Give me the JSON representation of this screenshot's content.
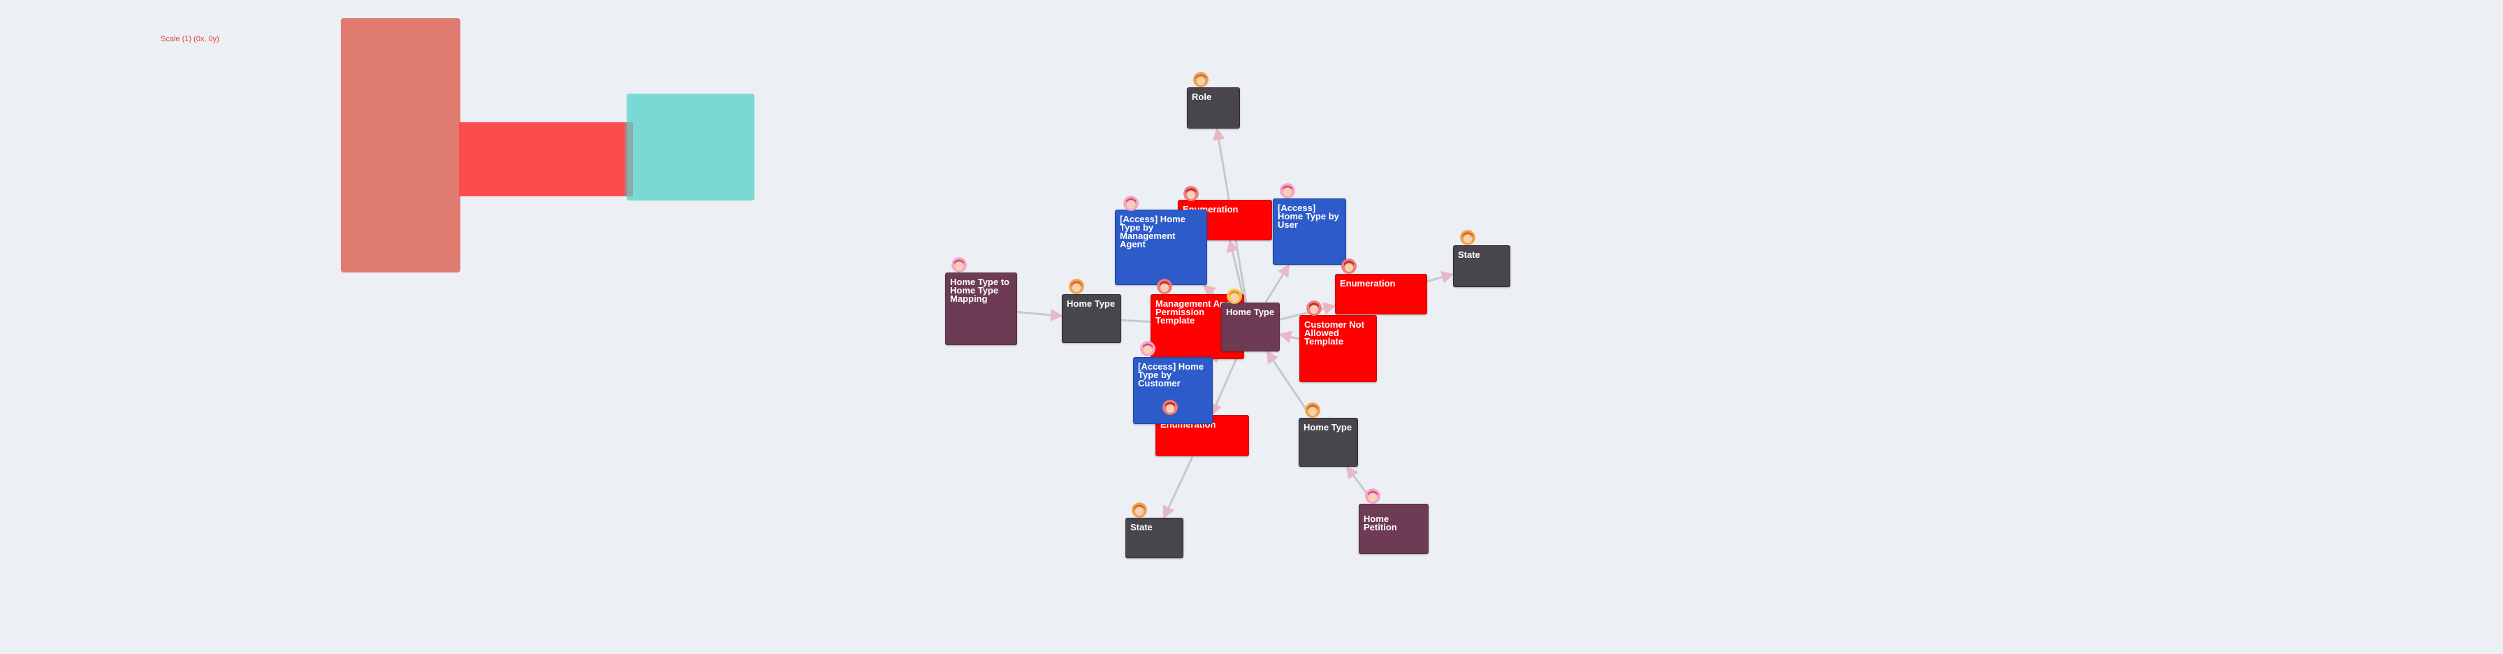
{
  "scale_label": "Scale (1) (0x, 0y)",
  "colors": {
    "background": "#eceff3",
    "minimap_block_a": "#e07b72",
    "minimap_block_b": "#fd4c4e",
    "minimap_block_c": "#7ad9d3",
    "node_dark": "#48464c",
    "node_red": "#fe0000",
    "node_blue": "#2d5bc9",
    "node_plum": "#6e3b55",
    "edge": "#c8c8cc"
  },
  "nodes": {
    "role": {
      "label": "Role",
      "type": "dark",
      "avatar": "orange-avatar-icon"
    },
    "enum_top": {
      "label": "Enumeration",
      "type": "red",
      "avatar": "red-avatar-icon"
    },
    "access_mgmt": {
      "label": "[Access] Home Type by Management Agent",
      "type": "blue",
      "avatar": "pink-avatar-icon"
    },
    "access_user": {
      "label": "[Access] Home Type by User",
      "type": "blue",
      "avatar": "pink-avatar-icon"
    },
    "state_right": {
      "label": "State",
      "type": "dark",
      "avatar": "orange-avatar-icon"
    },
    "enum_right": {
      "label": "Enumeration",
      "type": "red",
      "avatar": "red-avatar-icon"
    },
    "mapping": {
      "label": "Home Type to Home Type Mapping",
      "type": "plum",
      "avatar": "pink-avatar-icon"
    },
    "home_type_left": {
      "label": "Home Type",
      "type": "dark",
      "avatar": "orange-avatar-icon"
    },
    "mgmt_perm": {
      "label": "Management Agent Permission Template",
      "type": "red",
      "avatar": "red-avatar-icon"
    },
    "home_type_center": {
      "label": "Home Type",
      "type": "plum",
      "avatar": "yellow-avatar-icon"
    },
    "cust_not_allowed": {
      "label": "Customer Not Allowed Template",
      "type": "red",
      "avatar": "red-avatar-icon"
    },
    "access_cust": {
      "label": "[Access] Home Type by Customer",
      "type": "blue",
      "avatar": "pink-avatar-icon"
    },
    "enum_bottom": {
      "label": "Enumeration",
      "type": "red",
      "avatar": "red-avatar-icon"
    },
    "home_type_bottom": {
      "label": "Home Type",
      "type": "dark",
      "avatar": "orange-avatar-icon"
    },
    "state_bottom": {
      "label": "State",
      "type": "dark",
      "avatar": "orange-avatar-icon"
    },
    "petition": {
      "label": "Home Petition",
      "type": "plum",
      "avatar": "pink-avatar-icon"
    }
  },
  "edges": [
    [
      "home_type_center",
      "role"
    ],
    [
      "home_type_center",
      "enum_top"
    ],
    [
      "home_type_center",
      "access_mgmt"
    ],
    [
      "home_type_center",
      "access_user"
    ],
    [
      "home_type_center",
      "enum_right"
    ],
    [
      "enum_right",
      "state_right"
    ],
    [
      "mapping",
      "home_type_left"
    ],
    [
      "home_type_left",
      "home_type_center"
    ],
    [
      "mgmt_perm",
      "home_type_center"
    ],
    [
      "cust_not_allowed",
      "home_type_center"
    ],
    [
      "home_type_center",
      "enum_bottom"
    ],
    [
      "access_cust",
      "home_type_center"
    ],
    [
      "home_type_bottom",
      "home_type_center"
    ],
    [
      "enum_bottom",
      "state_bottom"
    ],
    [
      "petition",
      "home_type_bottom"
    ]
  ]
}
